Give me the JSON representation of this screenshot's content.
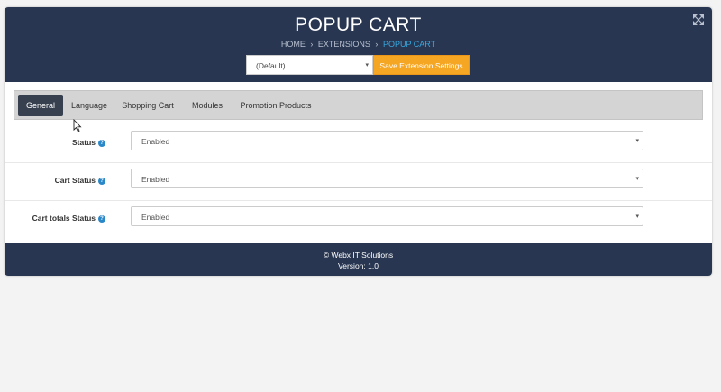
{
  "header": {
    "title": "POPUP CART",
    "breadcrumb": [
      "HOME",
      "EXTENSIONS",
      "POPUP CART"
    ],
    "breadcrumb_separator": "›",
    "expand_icon": "expand-arrows-icon",
    "store_select": {
      "value": "(Default)",
      "caret": "▾"
    },
    "save_label": "Save Extension Settings"
  },
  "tabs": [
    {
      "label": "General",
      "active": true
    },
    {
      "label": "Language",
      "active": false
    },
    {
      "label": "Shopping Cart",
      "active": false
    },
    {
      "label": "Modules",
      "active": false
    },
    {
      "label": "Promotion Products",
      "active": false
    }
  ],
  "form": {
    "help_glyph": "?",
    "rows": [
      {
        "label": "Status",
        "value": "Enabled"
      },
      {
        "label": "Cart Status",
        "value": "Enabled"
      },
      {
        "label": "Cart totals Status",
        "value": "Enabled"
      }
    ]
  },
  "footer": {
    "copyright": "© Webx IT Solutions",
    "version": "Version: 1.0"
  },
  "colors": {
    "header_bg": "#283651",
    "accent_orange": "#f5a623",
    "active_tab": "#37404f",
    "breadcrumb_active": "#3aa8e0",
    "help_icon": "#2a88c8"
  }
}
